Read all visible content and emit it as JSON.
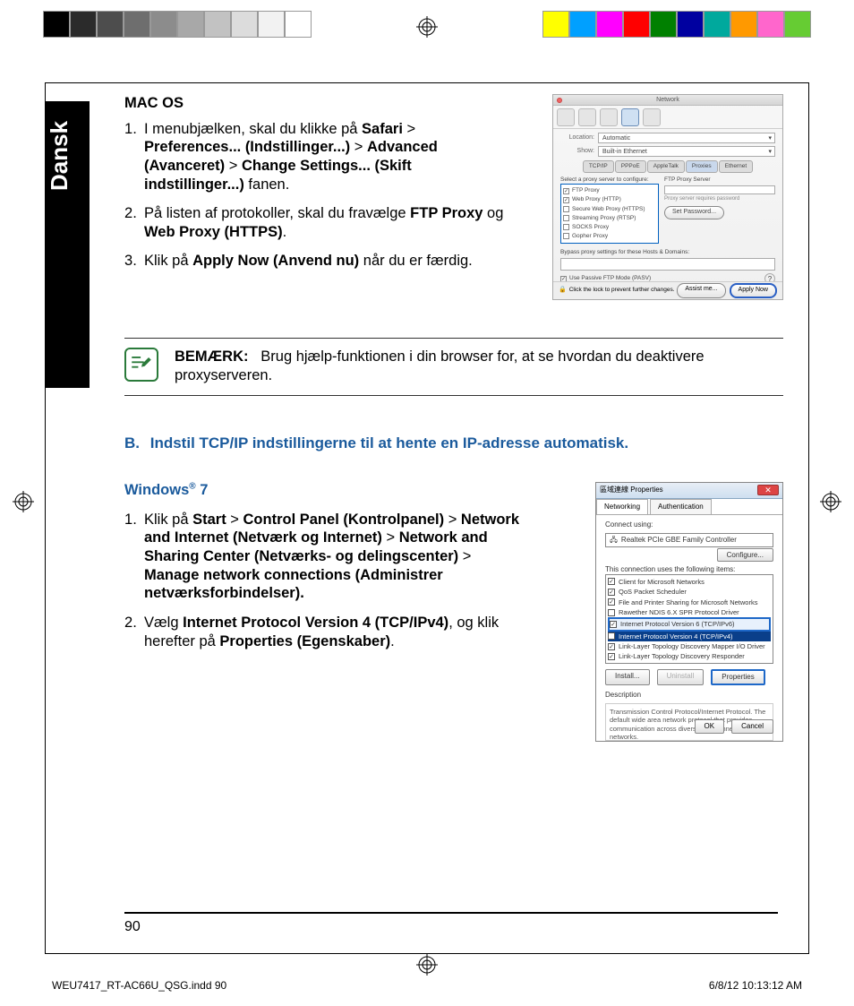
{
  "colorbar_left": [
    "#000000",
    "#2b2b2b",
    "#4d4d4d",
    "#6e6e6e",
    "#8c8c8c",
    "#a8a8a8",
    "#c2c2c2",
    "#dcdcdc",
    "#f2f2f2",
    "#ffffff"
  ],
  "colorbar_right": [
    "#ffff00",
    "#00a0ff",
    "#ff00ff",
    "#ff0000",
    "#008000",
    "#0000a0",
    "#00a99d",
    "#ff9900",
    "#ff66cc",
    "#66cc33"
  ],
  "sidebar_label": "Dansk",
  "macos_heading": "MAC OS",
  "macos_steps": [
    "I menubjælken, skal du klikke på <b>Safari</b> > <b>Preferences... (Indstillinger...)</b> > <b>Advanced (Avanceret)</b> > <b>Change Settings... (Skift indstillinger...)</b> fanen.",
    "På listen af protokoller, skal du fravælge <b>FTP Proxy</b> og <b>Web Proxy (HTTPS)</b>.",
    "Klik på <b>Apply Now (Anvend nu)</b> når du er færdig."
  ],
  "mac_fig": {
    "title": "Network",
    "location_label": "Location:",
    "location_value": "Automatic",
    "show_label": "Show:",
    "show_value": "Built-in Ethernet",
    "tabs": [
      "TCP/IP",
      "PPPoE",
      "AppleTalk",
      "Proxies",
      "Ethernet"
    ],
    "tabs_selected": 3,
    "list_label": "Select a proxy server to configure:",
    "server_label": "FTP Proxy Server",
    "pwd_label": "Proxy server requires password",
    "setpwd": "Set Password...",
    "protocols": [
      {
        "label": "FTP Proxy",
        "checked": true
      },
      {
        "label": "Web Proxy (HTTP)",
        "checked": true
      },
      {
        "label": "Secure Web Proxy (HTTPS)",
        "checked": false
      },
      {
        "label": "Streaming Proxy (RTSP)",
        "checked": false
      },
      {
        "label": "SOCKS Proxy",
        "checked": false
      },
      {
        "label": "Gopher Proxy",
        "checked": false
      }
    ],
    "bypass_label": "Bypass proxy settings for these Hosts & Domains:",
    "pasv_label": "Use Passive FTP Mode (PASV)",
    "lock_label": "Click the lock to prevent further changes.",
    "assist": "Assist me...",
    "apply": "Apply Now"
  },
  "note_label": "BEMÆRK:",
  "note_text": "Brug hjælp-funktionen i din browser for, at se hvordan du deaktivere proxyserveren.",
  "section_b_prefix": "B.",
  "section_b_text": "Indstil TCP/IP indstillingerne til at hente en IP-adresse automatisk.",
  "windows_heading": "Windows® 7",
  "windows_steps": [
    "Klik på <b>Start</b> > <b>Control Panel (Kontrolpanel)</b> > <b>Network and Internet (Netværk og Internet)</b> > <b>Network and Sharing Center (Netværks- og delingscenter)</b> > <b>Manage network connections (Administrer netværksforbindelser).</b>",
    "Vælg <b>Internet Protocol Version 4 (TCP/IPv4)</b>, og klik herefter på <b>Properties (Egenskaber)</b>."
  ],
  "win_fig": {
    "title": "區域連線 Properties",
    "tabs": [
      "Networking",
      "Authentication"
    ],
    "connect_label": "Connect using:",
    "adapter": "Realtek PCIe GBE Family Controller",
    "configure": "Configure...",
    "items_label": "This connection uses the following items:",
    "items": [
      {
        "label": "Client for Microsoft Networks",
        "checked": true
      },
      {
        "label": "QoS Packet Scheduler",
        "checked": true
      },
      {
        "label": "File and Printer Sharing for Microsoft Networks",
        "checked": true
      },
      {
        "label": "Rawether NDIS 6.X SPR Protocol Driver",
        "checked": false
      },
      {
        "label": "Internet Protocol Version 6 (TCP/IPv6)",
        "checked": true,
        "hl": true
      },
      {
        "label": "Internet Protocol Version 4 (TCP/IPv4)",
        "checked": true,
        "sel": true
      },
      {
        "label": "Link-Layer Topology Discovery Mapper I/O Driver",
        "checked": true
      },
      {
        "label": "Link-Layer Topology Discovery Responder",
        "checked": true
      }
    ],
    "install": "Install...",
    "uninstall": "Uninstall",
    "properties": "Properties",
    "desc_label": "Description",
    "desc_text": "Transmission Control Protocol/Internet Protocol. The default wide area network protocol that provides communication across diverse interconnected networks.",
    "ok": "OK",
    "cancel": "Cancel"
  },
  "page_number": "90",
  "footer_left": "WEU7417_RT-AC66U_QSG.indd   90",
  "footer_right": "6/8/12   10:13:12 AM"
}
